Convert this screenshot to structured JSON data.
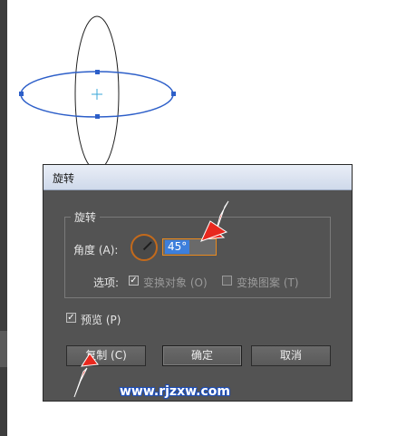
{
  "dialog": {
    "title": "旋转",
    "group_title": "旋转",
    "angle_label": "角度 (A):",
    "angle_value": "45°",
    "options_label": "选项:",
    "option_transform_objects": "变换对象 (O)",
    "option_transform_patterns": "变换图案 (T)",
    "preview_label": "预览 (P)",
    "copy_button": "复制 (C)",
    "ok_button": "确定",
    "cancel_button": "取消"
  },
  "states": {
    "transform_objects_checked": true,
    "transform_patterns_checked": false,
    "preview_checked": true
  },
  "watermark": "www.rjzxw.com",
  "colors": {
    "dialog_bg": "#535353",
    "accent_orange": "#ea8a1e",
    "selection_blue": "#3d7fdc",
    "arrow_red": "#e8281e",
    "path_blue": "#2d5fc9"
  }
}
